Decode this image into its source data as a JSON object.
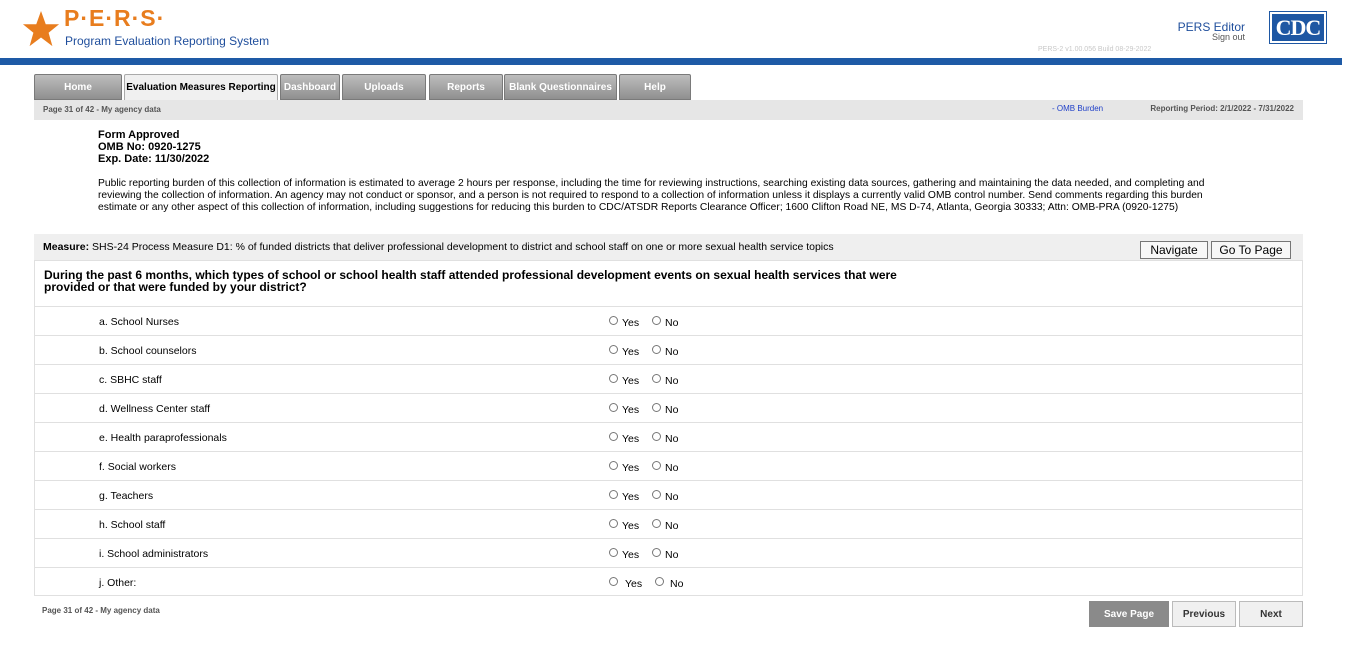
{
  "header": {
    "logo_title": "P·E·R·S·",
    "logo_subtitle": "Program Evaluation Reporting System",
    "user_name": "PERS Editor",
    "sign_out": "Sign out",
    "version": "PERS-2 v1.00.056    Build 08-29-2022",
    "agency_logo": "CDC"
  },
  "tabs": [
    {
      "label": "Home",
      "active": false
    },
    {
      "label": "Evaluation Measures Reporting",
      "active": true
    },
    {
      "label": "Dashboard",
      "active": false
    },
    {
      "label": "Uploads",
      "active": false
    },
    {
      "label": "Reports",
      "active": false
    },
    {
      "label": "Blank Questionnaires",
      "active": false
    },
    {
      "label": "Help",
      "active": false
    }
  ],
  "sub_bar": {
    "page_info": "Page 31 of 42 - My agency data",
    "omb_link": "- OMB Burden",
    "reporting_period": "Reporting Period: 2/1/2022 - 7/31/2022"
  },
  "form_approved": {
    "line1": "Form Approved",
    "line2": "OMB No: 0920-1275",
    "line3": "Exp. Date: 11/30/2022"
  },
  "burden_text": "Public reporting burden of this collection of information is estimated to average 2 hours per response, including the time for reviewing instructions, searching existing data sources, gathering and maintaining the data needed, and completing and reviewing the collection of information. An agency may not conduct or sponsor, and a person is not required to respond to a collection of information unless it displays a currently valid OMB control number. Send comments regarding this burden estimate or any other aspect of this collection of information, including suggestions for reducing this burden to CDC/ATSDR Reports Clearance Officer; 1600 Clifton Road NE, MS D-74, Atlanta, Georgia 30333; Attn: OMB-PRA (0920-1275)",
  "measure": {
    "label": "Measure:",
    "text": "SHS-24 Process Measure D1: % of funded districts that deliver professional development to district and school staff on one or more sexual health service topics",
    "navigate_button": "Navigate",
    "goto_button": "Go To Page"
  },
  "question": "During the past 6 months, which types of school or school health staff attended professional development events on sexual health services that were provided or that were funded by your district?",
  "options": {
    "yes": "Yes",
    "no": "No"
  },
  "items": [
    {
      "label": "a. School Nurses",
      "selected": null
    },
    {
      "label": "b. School counselors",
      "selected": null
    },
    {
      "label": "c. SBHC staff",
      "selected": null
    },
    {
      "label": "d. Wellness Center staff",
      "selected": null
    },
    {
      "label": "e. Health paraprofessionals",
      "selected": null
    },
    {
      "label": "f. Social workers",
      "selected": null
    },
    {
      "label": "g. Teachers",
      "selected": null
    },
    {
      "label": "h. School staff",
      "selected": null
    },
    {
      "label": "i. School administrators",
      "selected": null
    },
    {
      "label": "j. Other:",
      "selected": null
    }
  ],
  "footer": {
    "page_info": "Page 31 of 42 - My agency data",
    "save_button": "Save Page",
    "previous_button": "Previous",
    "next_button": "Next"
  },
  "colors": {
    "brand_blue": "#1e5aa6",
    "logo_orange": "#e87d1e"
  }
}
